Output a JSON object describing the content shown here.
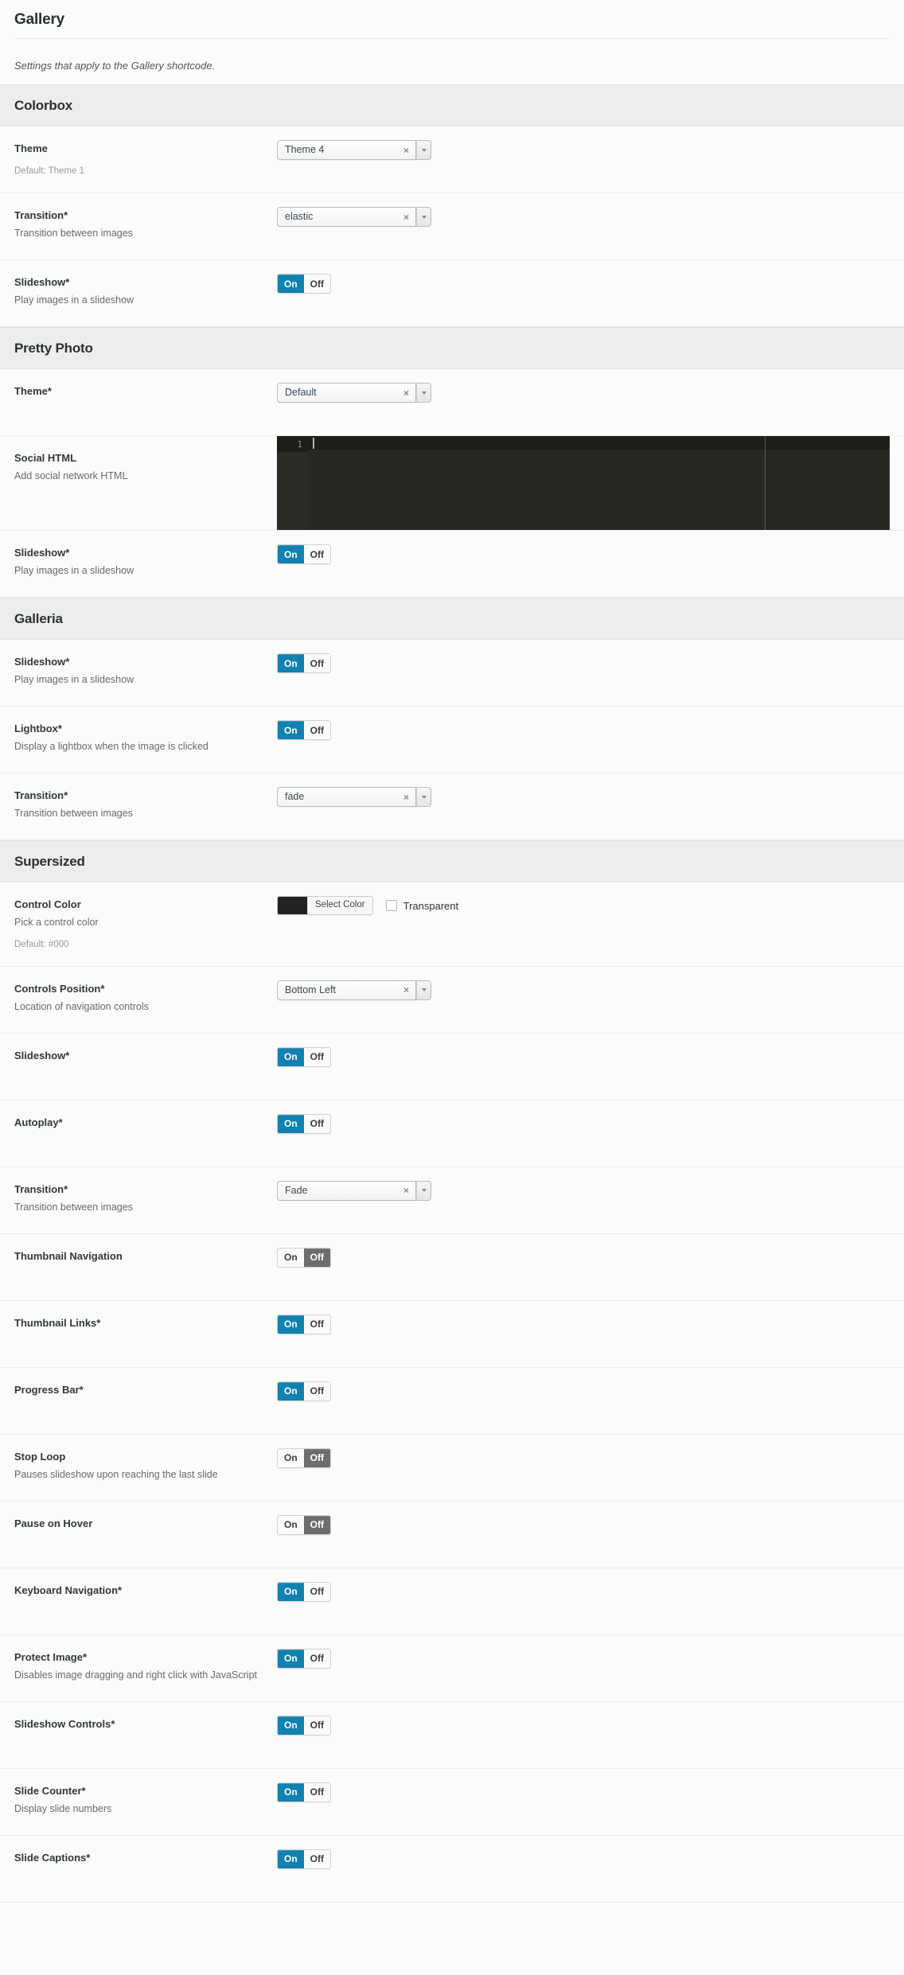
{
  "page": {
    "title": "Gallery",
    "description": "Settings that apply to the Gallery shortcode."
  },
  "colors": {
    "switch_on": "#1181b0",
    "switch_off": "#6d6d6d",
    "section_header_bg": "#ededed",
    "page_bg": "#fbfbfb",
    "editor_bg": "#272822",
    "control_color_swatch": "#222222"
  },
  "labels": {
    "on": "On",
    "off": "Off",
    "select_color": "Select Color",
    "transparent": "Transparent",
    "clear_icon": "×",
    "line_number": "1"
  },
  "sections": [
    {
      "name": "Colorbox",
      "fields": [
        {
          "title": "Theme",
          "sub": "",
          "default": "Default: Theme 1",
          "control": "select",
          "value": "Theme 4"
        },
        {
          "title": "Transition*",
          "sub": "Transition between images",
          "default": "",
          "control": "select",
          "value": "elastic"
        },
        {
          "title": "Slideshow*",
          "sub": "Play images in a slideshow",
          "default": "",
          "control": "switch",
          "value": "On"
        }
      ]
    },
    {
      "name": "Pretty Photo",
      "fields": [
        {
          "title": "Theme*",
          "sub": "",
          "default": "",
          "control": "select",
          "value": "Default"
        },
        {
          "title": "Social HTML",
          "sub": "Add social network HTML",
          "default": "",
          "control": "editor",
          "value": ""
        },
        {
          "title": "Slideshow*",
          "sub": "Play images in a slideshow",
          "default": "",
          "control": "switch",
          "value": "On"
        }
      ]
    },
    {
      "name": "Galleria",
      "fields": [
        {
          "title": "Slideshow*",
          "sub": "Play images in a slideshow",
          "default": "",
          "control": "switch",
          "value": "On"
        },
        {
          "title": "Lightbox*",
          "sub": "Display a lightbox when the image is clicked",
          "default": "",
          "control": "switch",
          "value": "On"
        },
        {
          "title": "Transition*",
          "sub": "Transition between images",
          "default": "",
          "control": "select",
          "value": "fade"
        }
      ]
    },
    {
      "name": "Supersized",
      "fields": [
        {
          "title": "Control Color",
          "sub": "Pick a control color",
          "default": "Default: #000",
          "control": "color",
          "value": "#000"
        },
        {
          "title": "Controls Position*",
          "sub": "Location of navigation controls",
          "default": "",
          "control": "select",
          "value": "Bottom Left"
        },
        {
          "title": "Slideshow*",
          "sub": "",
          "default": "",
          "control": "switch",
          "value": "On"
        },
        {
          "title": "Autoplay*",
          "sub": "",
          "default": "",
          "control": "switch",
          "value": "On"
        },
        {
          "title": "Transition*",
          "sub": "Transition between images",
          "default": "",
          "control": "select",
          "value": "Fade"
        },
        {
          "title": "Thumbnail Navigation",
          "sub": "",
          "default": "",
          "control": "switch",
          "value": "Off"
        },
        {
          "title": "Thumbnail Links*",
          "sub": "",
          "default": "",
          "control": "switch",
          "value": "On"
        },
        {
          "title": "Progress Bar*",
          "sub": "",
          "default": "",
          "control": "switch",
          "value": "On"
        },
        {
          "title": "Stop Loop",
          "sub": "Pauses slideshow upon reaching the last slide",
          "default": "",
          "control": "switch",
          "value": "Off"
        },
        {
          "title": "Pause on Hover",
          "sub": "",
          "default": "",
          "control": "switch",
          "value": "Off"
        },
        {
          "title": "Keyboard Navigation*",
          "sub": "",
          "default": "",
          "control": "switch",
          "value": "On"
        },
        {
          "title": "Protect Image*",
          "sub": "Disables image dragging and right click with JavaScript",
          "default": "",
          "control": "switch",
          "value": "On"
        },
        {
          "title": "Slideshow Controls*",
          "sub": "",
          "default": "",
          "control": "switch",
          "value": "On"
        },
        {
          "title": "Slide Counter*",
          "sub": "Display slide numbers",
          "default": "",
          "control": "switch",
          "value": "On"
        },
        {
          "title": "Slide Captions*",
          "sub": "",
          "default": "",
          "control": "switch",
          "value": "On"
        }
      ]
    }
  ]
}
